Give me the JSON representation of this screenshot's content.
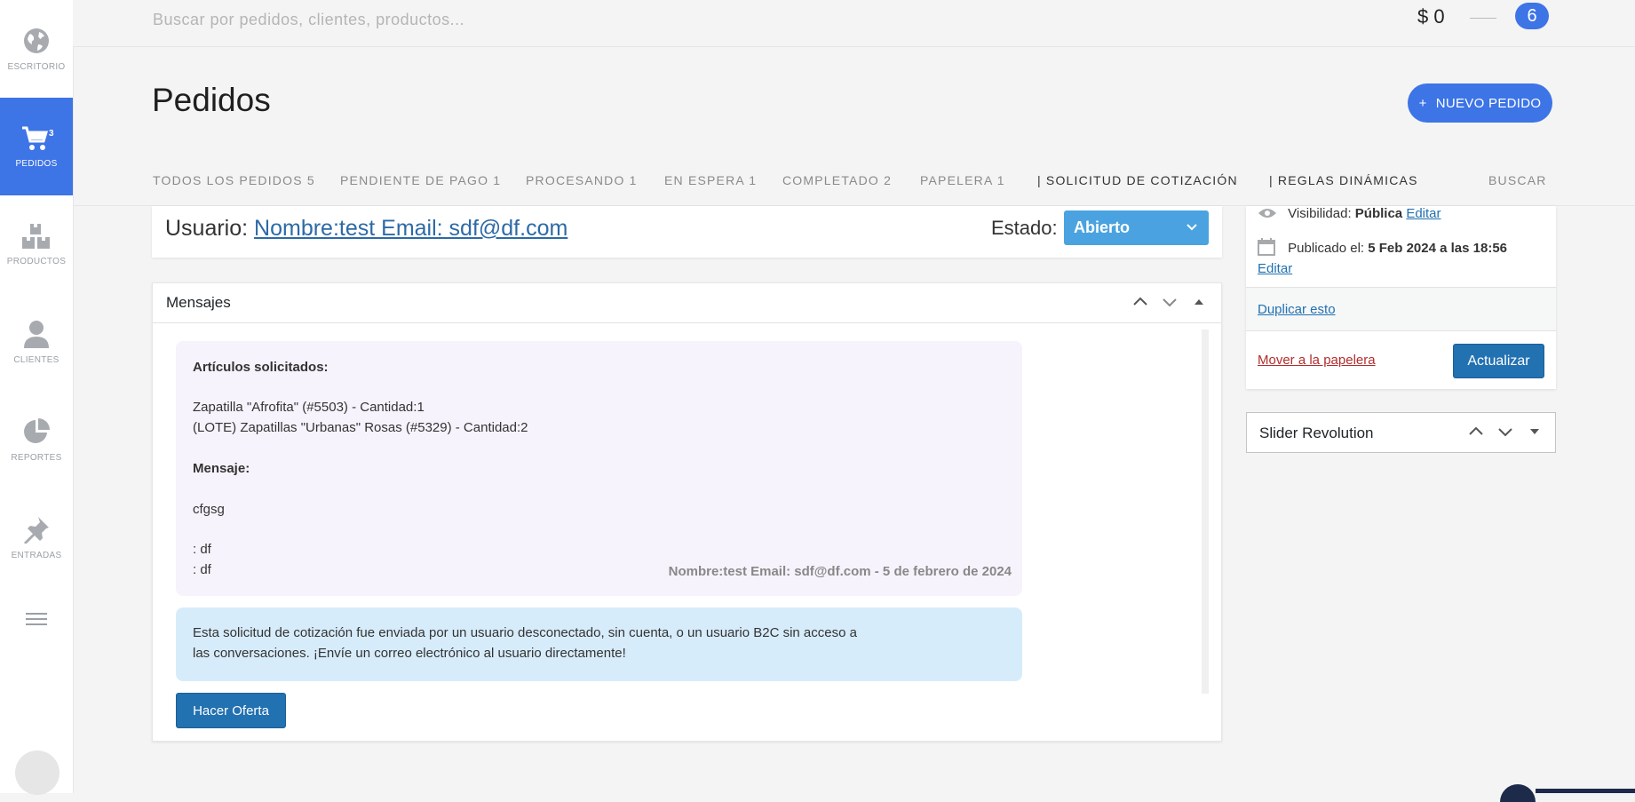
{
  "sidebar": {
    "items": [
      {
        "label": "ESCRITORIO",
        "icon": "globe-icon"
      },
      {
        "label": "PEDIDOS",
        "icon": "cart-icon",
        "badge": "3"
      },
      {
        "label": "PRODUCTOS",
        "icon": "boxes-icon"
      },
      {
        "label": "CLIENTES",
        "icon": "user-icon"
      },
      {
        "label": "REPORTES",
        "icon": "pie-chart-icon"
      },
      {
        "label": "ENTRADAS",
        "icon": "pin-icon"
      }
    ]
  },
  "topbar": {
    "search_placeholder": "Buscar por pedidos, clientes, productos...",
    "cart_total": "$ 0",
    "notification_count": "6"
  },
  "header": {
    "title": "Pedidos",
    "new_order_label": "NUEVO PEDIDO"
  },
  "tabs": [
    {
      "label": "TODOS LOS PEDIDOS 5"
    },
    {
      "label": "PENDIENTE DE PAGO 1"
    },
    {
      "label": "PROCESANDO 1"
    },
    {
      "label": "EN ESPERA 1"
    },
    {
      "label": "COMPLETADO 2"
    },
    {
      "label": "PAPELERA 1"
    },
    {
      "label": "| SOLICITUD DE COTIZACIÓN"
    },
    {
      "label": "| REGLAS DINÁMICAS"
    },
    {
      "label": "BUSCAR"
    }
  ],
  "user_card": {
    "prefix": "Usuario:",
    "user_link": "Nombre:test Email: sdf@df.com",
    "estado_label": "Estado:",
    "estado_value": "Abierto"
  },
  "messages": {
    "title": "Mensajes",
    "bubble": {
      "heading": "Artículos solicitados:",
      "item1": "Zapatilla \"Afrofita\" (#5503) - Cantidad:1",
      "item2": "(LOTE) Zapatillas \"Urbanas\" Rosas (#5329) - Cantidad:2",
      "message_heading": "Mensaje:",
      "message_text": "cfgsg",
      "field1": ": df",
      "field2": ": df",
      "signature": "Nombre:test Email: sdf@df.com - 5 de febrero de 2024"
    },
    "notice_line1": "Esta solicitud de cotización fue enviada por un usuario desconectado, sin cuenta, o un usuario B2C sin acceso a",
    "notice_line2": "las conversaciones. ¡Envíe un correo electrónico al usuario directamente!",
    "offer_button": "Hacer Oferta"
  },
  "publish": {
    "visibility_label": "Visibilidad:",
    "visibility_value": "Pública",
    "visibility_edit": "Editar",
    "published_label": "Publicado el:",
    "published_value": "5 Feb 2024 a las 18:56",
    "published_edit": "Editar",
    "duplicate": "Duplicar esto",
    "trash": "Mover a la papelera",
    "update_button": "Actualizar"
  },
  "slider_panel": {
    "title": "Slider Revolution"
  },
  "colors": {
    "accent": "#3d74e6",
    "wp_button": "#2271b1",
    "estado_select": "#4aa3e0",
    "bubble_bg": "#f7f3fc",
    "notice_bg": "#d7ecfb"
  }
}
